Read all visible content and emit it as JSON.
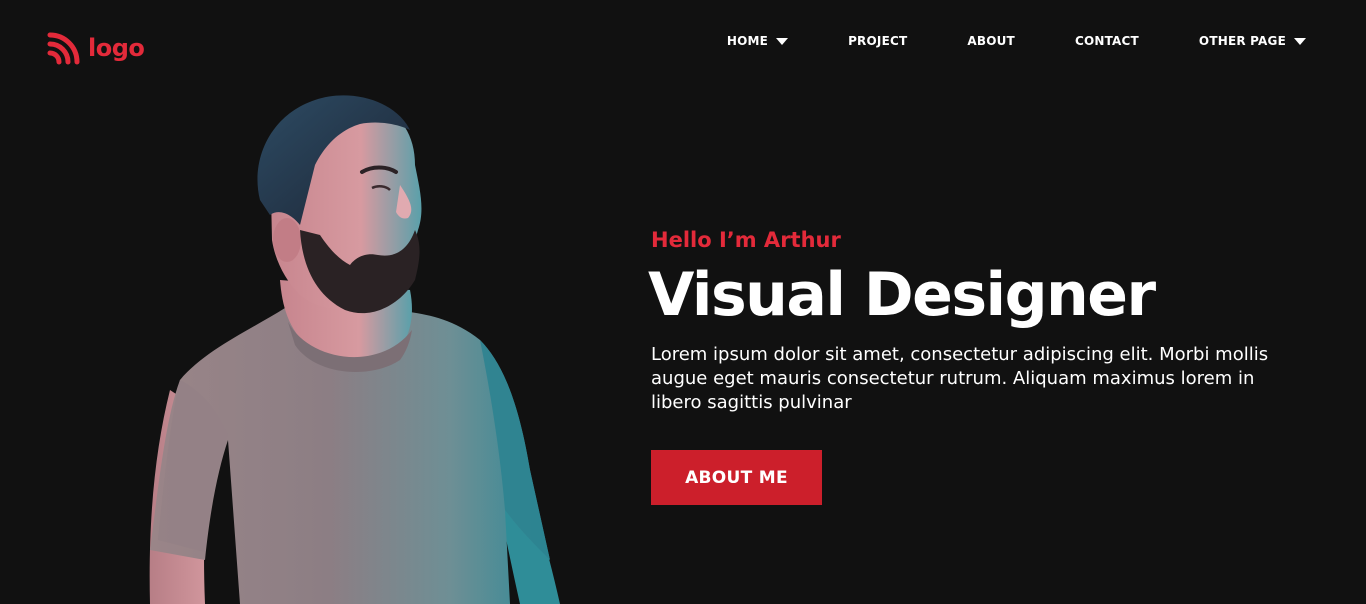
{
  "header": {
    "logo_text": "logo",
    "logo_icon": "rss-waves-icon"
  },
  "nav": {
    "items": [
      {
        "label": "HOME",
        "has_dropdown": true
      },
      {
        "label": "PROJECT",
        "has_dropdown": false
      },
      {
        "label": "ABOUT",
        "has_dropdown": false
      },
      {
        "label": "CONTACT",
        "has_dropdown": false
      },
      {
        "label": "OTHER PAGE",
        "has_dropdown": true
      }
    ]
  },
  "hero": {
    "greeting": "Hello I’m Arthur",
    "headline": "Visual Designer",
    "description": "Lorem ipsum dolor sit amet, consectetur adipiscing elit. Morbi mollis augue eget mauris consectetur rutrum. Aliquam maximus lorem in libero sagittis pulvinar",
    "cta_label": "ABOUT ME"
  },
  "colors": {
    "background": "#111111",
    "accent": "#e32a3a",
    "button": "#cc1f2b",
    "text": "#ffffff"
  }
}
